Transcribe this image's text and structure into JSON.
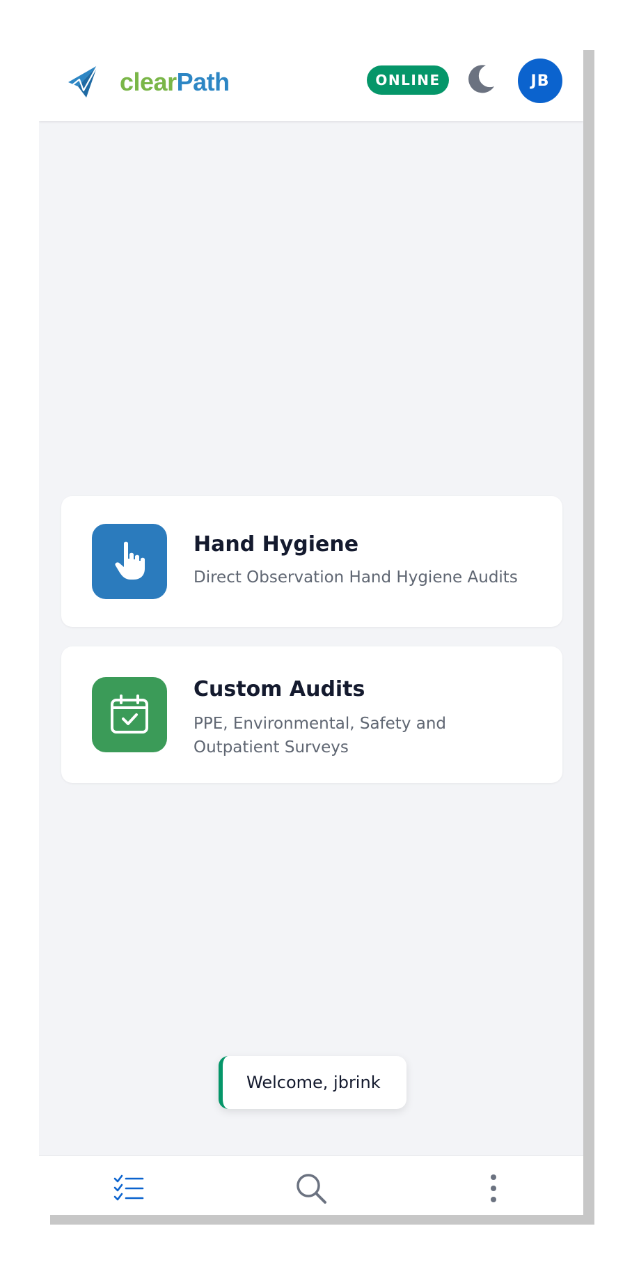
{
  "app": {
    "brand_part1": "clear",
    "brand_part2": "Path",
    "brand_colors": {
      "clear": "#7ab648",
      "path": "#2d86c4"
    }
  },
  "header": {
    "status_badge": "ONLINE",
    "status_color": "#059669",
    "theme_toggle_icon": "moon-icon",
    "avatar_initials": "JB",
    "avatar_color": "#0b63ce"
  },
  "modules": [
    {
      "title": "Hand Hygiene",
      "description": "Direct Observation Hand Hygiene Audits",
      "icon": "hand-pointer-icon",
      "color": "#2b7bbd"
    },
    {
      "title": "Custom Audits",
      "description": "PPE, Environmental, Safety and Outpatient Surveys",
      "icon": "calendar-check-icon",
      "color": "#3b9b58"
    }
  ],
  "toast": {
    "message": "Welcome, jbrink",
    "accent_color": "#059669"
  },
  "bottom_nav": {
    "items": [
      {
        "icon": "task-list-icon",
        "active": true
      },
      {
        "icon": "search-icon",
        "active": false
      },
      {
        "icon": "more-vertical-icon",
        "active": false
      }
    ]
  }
}
